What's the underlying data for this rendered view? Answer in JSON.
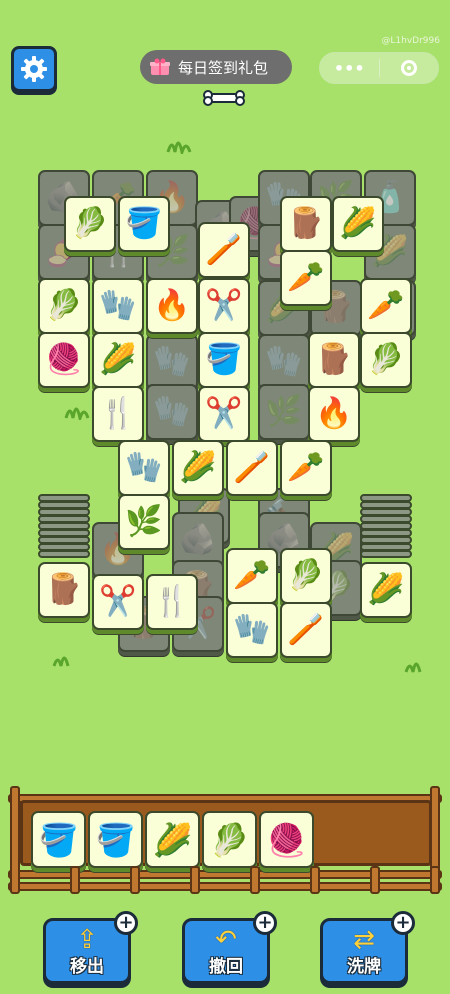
{
  "top_bar": {
    "user_id": "@L1hvDr996",
    "gift_label": "每日签到礼包",
    "capsule_menu": "•••"
  },
  "board": {
    "covered_tiles": [
      {
        "icon": "🪨"
      },
      {
        "icon": "🥕"
      },
      {
        "icon": "🔥"
      },
      {
        "icon": "🪨"
      },
      {
        "icon": "🧶"
      },
      {
        "icon": "🧤"
      },
      {
        "icon": "🌿"
      },
      {
        "icon": "🧴"
      },
      {
        "icon": "🍠"
      },
      {
        "icon": "🍴"
      },
      {
        "icon": "🌿"
      },
      {
        "icon": "🍠"
      },
      {
        "icon": "🌽"
      },
      {
        "icon": "🌽"
      },
      {
        "icon": "🌽"
      },
      {
        "icon": "🪵"
      },
      {
        "icon": "🧤"
      },
      {
        "icon": "🧤"
      },
      {
        "icon": "🥕"
      },
      {
        "icon": "🪣"
      },
      {
        "icon": "🧤"
      },
      {
        "icon": "🌿"
      },
      {
        "icon": "🌽"
      },
      {
        "icon": "🔨"
      },
      {
        "icon": "🪨"
      },
      {
        "icon": "🪨"
      },
      {
        "icon": "🔥"
      },
      {
        "icon": "🪵"
      },
      {
        "icon": "✂️"
      },
      {
        "icon": "🌽"
      },
      {
        "icon": "🥬"
      },
      {
        "icon": "🪵"
      }
    ],
    "open_tiles": [
      {
        "icon": "🥬"
      },
      {
        "icon": "🪣"
      },
      {
        "icon": "🪵"
      },
      {
        "icon": "🌽"
      },
      {
        "icon": "🪥"
      },
      {
        "icon": "🥕"
      },
      {
        "icon": "🥬"
      },
      {
        "icon": "🧤"
      },
      {
        "icon": "🔥"
      },
      {
        "icon": "✂️"
      },
      {
        "icon": "🥕"
      },
      {
        "icon": "🧶"
      },
      {
        "icon": "🌽"
      },
      {
        "icon": "🪣"
      },
      {
        "icon": "🪵"
      },
      {
        "icon": "🥬"
      },
      {
        "icon": "🍴"
      },
      {
        "icon": "✂️"
      },
      {
        "icon": "🔥"
      },
      {
        "icon": "🧤"
      },
      {
        "icon": "🌽"
      },
      {
        "icon": "🪥"
      },
      {
        "icon": "🥕"
      },
      {
        "icon": "🌿"
      },
      {
        "icon": "🥕"
      },
      {
        "icon": "🥬"
      },
      {
        "icon": "🪵"
      },
      {
        "icon": "✂️"
      },
      {
        "icon": "🍴"
      },
      {
        "icon": "🧤"
      },
      {
        "icon": "🪥"
      },
      {
        "icon": "🌽"
      }
    ],
    "left_stack_count": 9,
    "right_stack_count": 9
  },
  "tray": {
    "capacity": 7,
    "slots": [
      {
        "icon": "🪣"
      },
      {
        "icon": "🪣"
      },
      {
        "icon": "🌽"
      },
      {
        "icon": "🥬"
      },
      {
        "icon": "🧶"
      }
    ]
  },
  "toolbar": {
    "move_out_label": "移出",
    "undo_label": "撤回",
    "shuffle_label": "洗牌",
    "plus_symbol": "+",
    "move_out_icon": "move-out-arrow",
    "undo_icon": "undo-arrow",
    "shuffle_icon": "shuffle-arrows"
  },
  "colors": {
    "background": "#a8e16a",
    "button_blue": "#2e8fe6",
    "tile_face": "#fbffd8",
    "tray_wood": "#9a5a1e"
  }
}
